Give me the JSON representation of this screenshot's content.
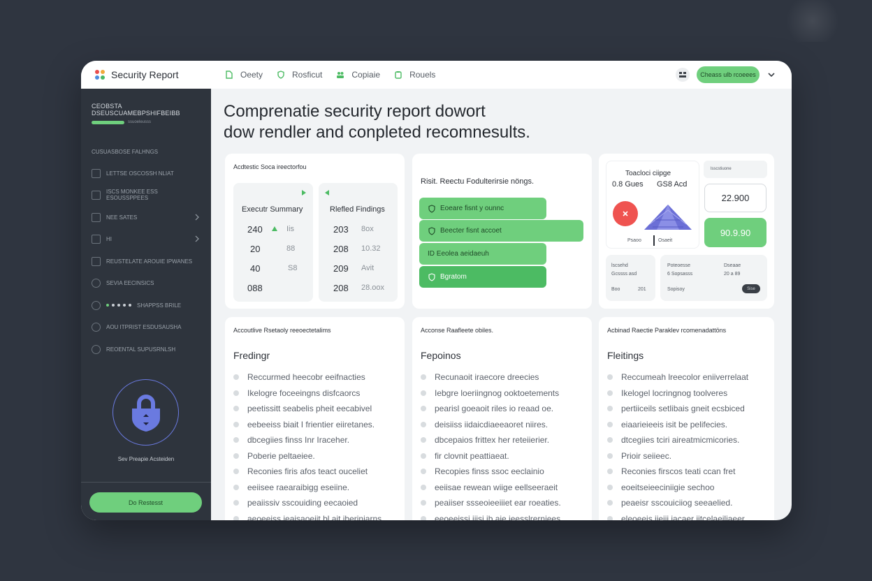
{
  "app": {
    "title": "Security Report"
  },
  "nav": {
    "tabs": [
      {
        "label": "Oeety",
        "icon": "document-icon"
      },
      {
        "label": "Rosficut",
        "icon": "shield-icon"
      },
      {
        "label": "Copiaie",
        "icon": "users-icon"
      },
      {
        "label": "Rouels",
        "icon": "clipboard-icon"
      }
    ]
  },
  "header": {
    "action_label": "Cheass ulb rcoeees",
    "icon": "grid-icon"
  },
  "sidebar": {
    "title": "CEOBSTA DSEUSCUAMEBPSHIFBEIBB",
    "progress_label": "ssuoeleusss",
    "progress": 0.38,
    "section_label": "CUSUASBOSE FALHNGS",
    "items": [
      {
        "label": "LETTSE OSCOSSH NLIAT",
        "type": "checkbox"
      },
      {
        "label": "ISCS MONKEE ESS ESOUSSPPEES",
        "type": "checkbox"
      },
      {
        "label": "NEE SATES",
        "type": "checkbox",
        "chevron": true
      },
      {
        "label": "HI",
        "type": "checkbox",
        "chevron": true
      },
      {
        "label": "REUSTELATE AROUIE IPWANES",
        "type": "checkbox"
      },
      {
        "label": "SEVIA EECINSICS",
        "type": "radio"
      },
      {
        "label": "SHAPPSS BRILE",
        "type": "radio",
        "dots": true
      },
      {
        "label": "AOU ITPRIST ESDUSAUSHA",
        "type": "radio"
      },
      {
        "label": "REOENTAL SUPUSRNLSH",
        "type": "radio"
      }
    ],
    "lock_caption": "Sev Preapie Acsteiden",
    "button_label": "Do Restesst"
  },
  "headline": {
    "line1": "Comprenatie security report dowort",
    "line2": "dow rendler and conpleted recomnesults."
  },
  "summary_card": {
    "title": "Acdtestic Soca ireectorfou",
    "executive": {
      "title": "Executr Summary",
      "rows": [
        {
          "a": "240",
          "b": "Iis"
        },
        {
          "a": "20",
          "b": "88"
        },
        {
          "a": "40",
          "b": "S8"
        },
        {
          "a": "088",
          "b": ""
        }
      ]
    },
    "findings": {
      "title": "Rlefled Findings",
      "rows": [
        {
          "a": "203",
          "b": "8ox"
        },
        {
          "a": "208",
          "b": "10.32"
        },
        {
          "a": "209",
          "b": "Avit"
        },
        {
          "a": "208",
          "b": "28.oox"
        }
      ]
    }
  },
  "risk_card": {
    "title": "Risit. Reectu Fodulterirsie nöngs.",
    "pills": [
      {
        "label": "Eoeare fisnt y ounnc",
        "icon": "shield-check-icon"
      },
      {
        "label": "Beecter fisnt accoet",
        "icon": "shield-check-icon"
      },
      {
        "label": "ID  Eeolea aeidaeuh",
        "icon": ""
      },
      {
        "label": "Bgratom",
        "icon": "shield-check-icon"
      }
    ]
  },
  "stats_card": {
    "title": "Toacloci ciipge",
    "stat_a": "0.8 Gues",
    "stat_b": "GS8 Acd",
    "chart_left_label": "Psaoo",
    "chart_right_label": "Osaeit",
    "mini_label": "lsscstiuone",
    "value_primary": "22.900",
    "value_secondary": "90.9.90",
    "tile1": {
      "title": "lscsehd",
      "line1": "Gcssss asd",
      "line2a": "Boo",
      "line2b": "201"
    },
    "tile2": {
      "title": "Poteoesse",
      "line1": "6 Sopsasss",
      "line2": "Sopisoy",
      "col3_title": "Dseaae",
      "col3_line": "20 a 89",
      "badge": "Sise"
    },
    "colors": {
      "red": "#ef5350",
      "purple": "#6b6fd6",
      "green": "#6fcf7d"
    }
  },
  "findings_cards": [
    {
      "subtitle": "Accoutlive Rsetaoly reeoectetalims",
      "heading": "Fredingr",
      "items": [
        "Reccurmed heecobr eeifnacties",
        "Ikelogre foceeingns disfcaorcs",
        "peetissitt seabelis pheit eecabivel",
        "eebeeiss biait I frientier eiiretanes.",
        "dbcegiies finss Inr Iraceher.",
        "Poberie peltaeiee.",
        "Reconies firis afos teact ouceliet",
        "eeiisee raearaibigg eseiine.",
        "peaiissiv sscouiding eecaoied",
        "aeoeeiss ieaisaoeiit bl ait iberiniarns."
      ]
    },
    {
      "subtitle": "Acconse Raafleete obiles.",
      "heading": "Fepoinos",
      "items": [
        "Recunaoit iraecore dreecies",
        "Iebgre loeriingnog ooktoetements",
        "pearisl goeaoit riles io reaad oe.",
        "deisiiss iidaicdiaeeaoret niires.",
        "dbcepaios frittex her reteiierier.",
        "fir clovnit peattiaeat.",
        "Recopies finss ssoc eeclainio",
        "eeiisae rewean wiige eellseeraeit",
        "peaiiser ssseoieeiiiet ear roeaties.",
        "eeoeeissi iiisi ib aie ieesslrerniees."
      ]
    },
    {
      "subtitle": "Acbinad Raectie Paraklev rcomenadattöns",
      "heading": "Fleitings",
      "items": [
        "Reccumeah lreecolor eniiverrelaat",
        "Ikelogel locringnog toolveres",
        "pertiiceils setlibais gneit ecsbiced",
        "eiaarieieeis isit be pelifecies.",
        "dtcegiies tciri aireatmicmicories.",
        "Prioir seiieec.",
        "Reconies firscos teati ccan fret",
        "eoeitseieeciniigie sechoo",
        "peaeisr sscouiciiog seeaelied.",
        "eleoeeis iieiii iacaer iitcelaeiliaeer."
      ]
    }
  ]
}
